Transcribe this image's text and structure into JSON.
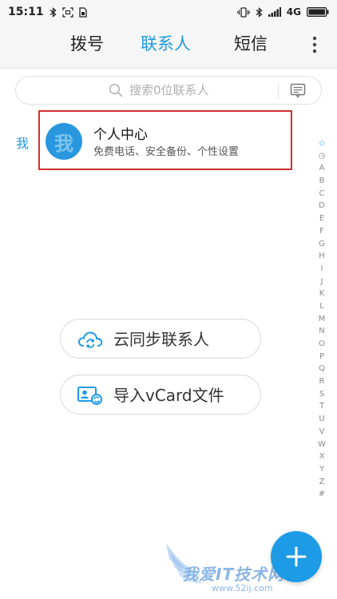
{
  "status_bar": {
    "time": "15:11",
    "network": "4G",
    "icons_left": [
      "bluetooth-icon",
      "screenshot-icon",
      "sim-icon"
    ],
    "icons_right": [
      "vibrate-icon",
      "bluetooth-icon",
      "signal-icon",
      "battery-icon"
    ]
  },
  "tabs": [
    {
      "label": "拨号",
      "active": false
    },
    {
      "label": "联系人",
      "active": true
    },
    {
      "label": "短信",
      "active": false
    }
  ],
  "search": {
    "placeholder": "搜索0位联系人"
  },
  "me": {
    "label": "我",
    "avatar_glyph": "我",
    "title": "个人中心",
    "subtitle": "免费电话、安全备份、个性设置"
  },
  "alpha_index": [
    "☆",
    "◷",
    "A",
    "B",
    "C",
    "D",
    "E",
    "F",
    "G",
    "H",
    "I",
    "J",
    "K",
    "L",
    "M",
    "N",
    "O",
    "P",
    "Q",
    "R",
    "S",
    "T",
    "U",
    "V",
    "W",
    "X",
    "Y",
    "Z",
    "#"
  ],
  "actions": {
    "sync_label": "云同步联系人",
    "import_label": "导入vCard文件"
  },
  "watermark": {
    "text": "我爱IT技术网",
    "url": "www.52ij.com"
  },
  "colors": {
    "accent": "#1e9be6",
    "highlight_border": "#d0302f",
    "avatar_bg": "#2897de"
  }
}
